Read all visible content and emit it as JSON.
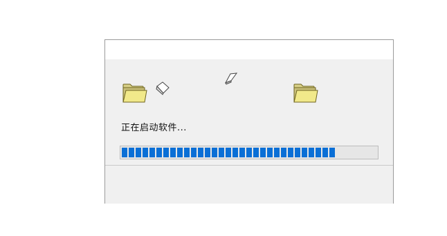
{
  "dialog": {
    "title": "",
    "status_text": "正在启动软件...",
    "progress": 0.85
  },
  "colors": {
    "progress_block": "#0a6fd6",
    "folder_fill": "#f1e98a",
    "folder_outline": "#8a7a2a"
  },
  "icons": {
    "source_folder": "folder-icon",
    "destination_folder": "folder-icon",
    "flying_document": "document-icon"
  }
}
